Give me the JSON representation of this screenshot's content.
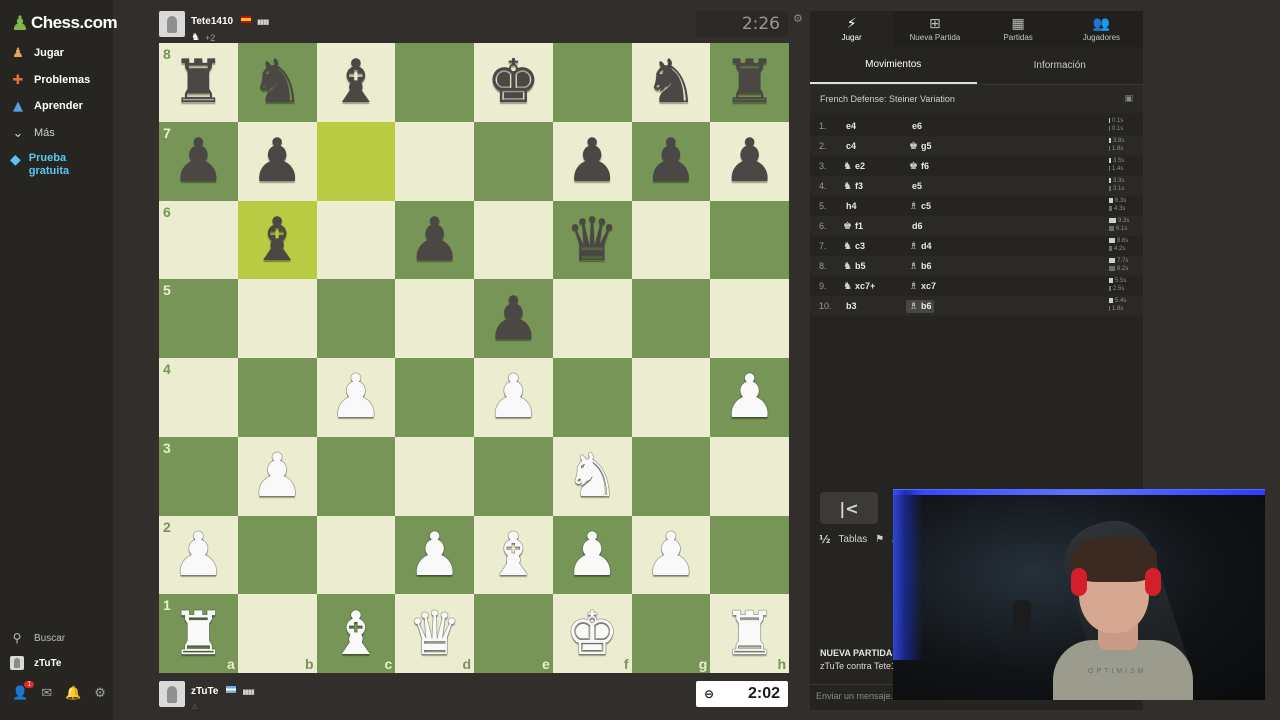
{
  "sidebar": {
    "logo_text": "Chess.com",
    "items": [
      {
        "label": "Jugar",
        "icon": "play-hand-icon",
        "glyph": "♟",
        "color": "#e7a35a"
      },
      {
        "label": "Problemas",
        "icon": "puzzle-icon",
        "glyph": "✚",
        "color": "#e2703a"
      },
      {
        "label": "Aprender",
        "icon": "graduation-cap-icon",
        "glyph": "▲",
        "color": "#5aa0e6"
      },
      {
        "label": "Más",
        "icon": "chevron-down-icon",
        "glyph": "⌄",
        "color": "#bdbdbd"
      }
    ],
    "trial_label": "Prueba gratuita",
    "search_label": "Buscar",
    "user_label": "zTuTe",
    "notif_count": "1"
  },
  "players": {
    "top": {
      "name": "Tete1410",
      "extra": "+2",
      "clock": "2:26"
    },
    "bottom": {
      "name": "zTuTe",
      "clock": "2:02"
    }
  },
  "board": {
    "pieces": [
      "♜♞♝.♚.♞♜",
      "♟♟...♟♟♟",
      ".♝.♟.♛..",
      "....♟...",
      "..♙.♙..♙",
      ".♙...♘..",
      "♙..♙♗♙♙.",
      "♖.♗♕.♔.♖"
    ],
    "highlight": [
      "c7",
      "b6"
    ],
    "ranks": [
      "8",
      "7",
      "6",
      "5",
      "4",
      "3",
      "2",
      "1"
    ],
    "files": [
      "a",
      "b",
      "c",
      "d",
      "e",
      "f",
      "g",
      "h"
    ]
  },
  "panel": {
    "tabs": [
      {
        "label": "Jugar",
        "icon": "lightning-icon",
        "glyph": "⚡"
      },
      {
        "label": "Nueva Partida",
        "icon": "plus-square-icon",
        "glyph": "⊞"
      },
      {
        "label": "Partidas",
        "icon": "chessboard-icon",
        "glyph": "▦"
      },
      {
        "label": "Jugadores",
        "icon": "users-icon",
        "glyph": "👥"
      }
    ],
    "subtabs": [
      "Movimientos",
      "Información"
    ],
    "opening": "French Defense: Steiner Variation",
    "moves": [
      {
        "n": "1.",
        "wp": "",
        "w": "e4",
        "bp": "",
        "b": "e6",
        "tw": "0.1s",
        "tb": "0.1s",
        "bw": 1,
        "bb": 1
      },
      {
        "n": "2.",
        "wp": "",
        "w": "c4",
        "bp": "♚",
        "b": "g5",
        "tw": "3.8s",
        "tb": "1.8s",
        "bw": 2,
        "bb": 1
      },
      {
        "n": "3.",
        "wp": "♞",
        "w": "e2",
        "bp": "♚",
        "b": "f6",
        "tw": "3.5s",
        "tb": "1.4s",
        "bw": 2,
        "bb": 1
      },
      {
        "n": "4.",
        "wp": "♞",
        "w": "f3",
        "bp": "",
        "b": "e5",
        "tw": "3.3s",
        "tb": "3.1s",
        "bw": 2,
        "bb": 2
      },
      {
        "n": "5.",
        "wp": "",
        "w": "h4",
        "bp": "♗",
        "b": "c5",
        "tw": "6.3s",
        "tb": "4.3s",
        "bw": 4,
        "bb": 3
      },
      {
        "n": "6.",
        "wp": "♚",
        "w": "f1",
        "bp": "",
        "b": "d6",
        "tw": "9.3s",
        "tb": "6.1s",
        "bw": 7,
        "bb": 5
      },
      {
        "n": "7.",
        "wp": "♞",
        "w": "c3",
        "bp": "♗",
        "b": "d4",
        "tw": "8.6s",
        "tb": "4.2s",
        "bw": 6,
        "bb": 3
      },
      {
        "n": "8.",
        "wp": "♞",
        "w": "b5",
        "bp": "♗",
        "b": "b6",
        "tw": "7.7s",
        "tb": "8.2s",
        "bw": 6,
        "bb": 6
      },
      {
        "n": "9.",
        "wp": "♞",
        "w": "xc7+",
        "bp": "♗",
        "b": "xc7",
        "tw": "5.5s",
        "tb": "2.5s",
        "bw": 4,
        "bb": 2
      },
      {
        "n": "10.",
        "wp": "",
        "w": "b3",
        "bp": "♗",
        "b": "b6",
        "tw": "5.4s",
        "tb": "1.8s",
        "bw": 4,
        "bb": 1
      }
    ],
    "draw_label": "Tablas",
    "draw_icon": "½",
    "resign_label": "A",
    "newgame_title": "NUEVA PARTIDA",
    "newgame_sub": "zTuTe contra Tete1",
    "chat_placeholder": "Enviar un mensaje...",
    "webcam_shirt_text": "OPTIMISM"
  }
}
